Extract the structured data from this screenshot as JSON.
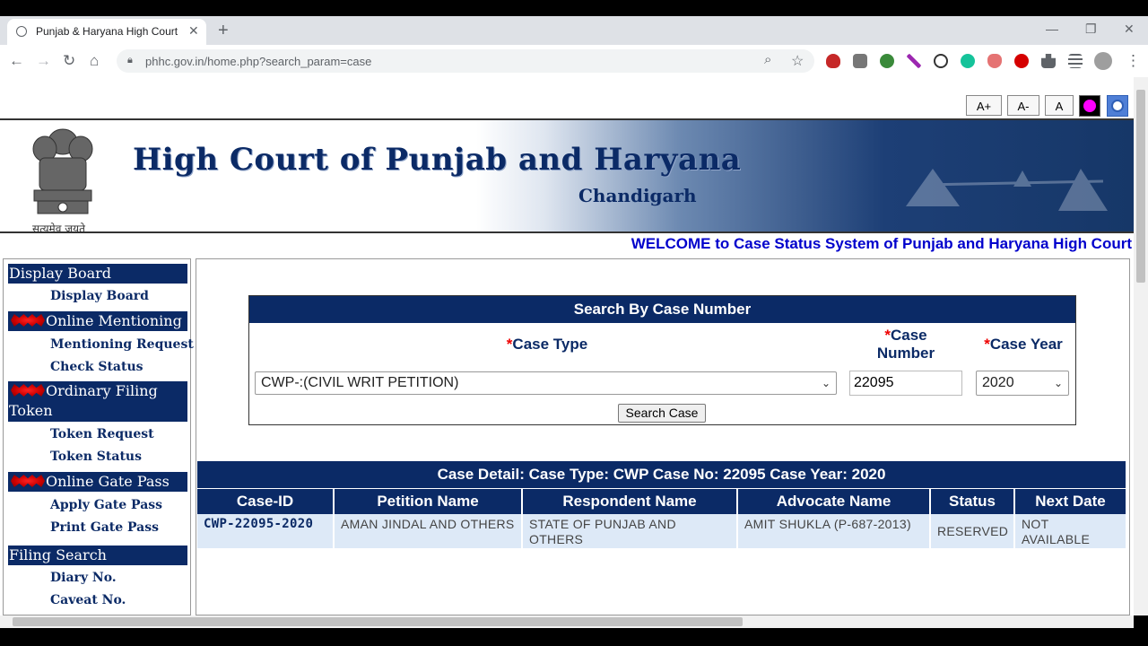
{
  "browser": {
    "tab_title": "Punjab & Haryana High Court",
    "url": "phhc.gov.in/home.php?search_param=case"
  },
  "font_controls": {
    "increase": "A+",
    "decrease": "A-",
    "reset": "A"
  },
  "header": {
    "emblem_text": "सत्यमेव जयते",
    "title": "High Court of Punjab and Haryana",
    "city": "Chandigarh",
    "welcome": "WELCOME to Case Status System of Punjab and Haryana High Court"
  },
  "sidebar": {
    "display_board": {
      "title": "Display Board",
      "items": [
        "Display Board"
      ]
    },
    "online_mentioning": {
      "title": "Online Mentioning",
      "items": [
        "Mentioning Request",
        "Check Status"
      ]
    },
    "ordinary_filing": {
      "title": "Ordinary Filing Token",
      "items": [
        "Token Request",
        "Token Status"
      ]
    },
    "gate_pass": {
      "title": "Online Gate Pass",
      "items": [
        "Apply Gate Pass",
        "Print Gate Pass"
      ]
    },
    "filing_search": {
      "title": "Filing Search",
      "items": [
        "Diary No.",
        "Caveat No."
      ]
    }
  },
  "search": {
    "heading": "Search By Case Number",
    "case_type_label": "Case Type",
    "case_number_label": "Case Number",
    "case_year_label": "Case Year",
    "required_mark": "*",
    "case_type_value": "CWP-:(CIVIL WRIT PETITION)",
    "case_number_value": "22095",
    "case_year_value": "2020",
    "button": "Search Case"
  },
  "result": {
    "heading": "Case Detail: Case Type: CWP Case No: 22095 Case Year: 2020",
    "columns": [
      "Case-ID",
      "Petition Name",
      "Respondent Name",
      "Advocate Name",
      "Status",
      "Next Date"
    ],
    "row": {
      "case_id": "CWP-22095-2020",
      "petition": "AMAN JINDAL AND OTHERS",
      "respondent": "STATE OF PUNJAB AND OTHERS",
      "advocate": "AMIT SHUKLA (P-687-2013)",
      "status": "RESERVED",
      "next_date": "NOT AVAILABLE"
    }
  },
  "colors": {
    "navy": "#0b2a66",
    "row_bg": "#dde9f7",
    "welcome": "#0000cc",
    "required": "#e00000"
  }
}
